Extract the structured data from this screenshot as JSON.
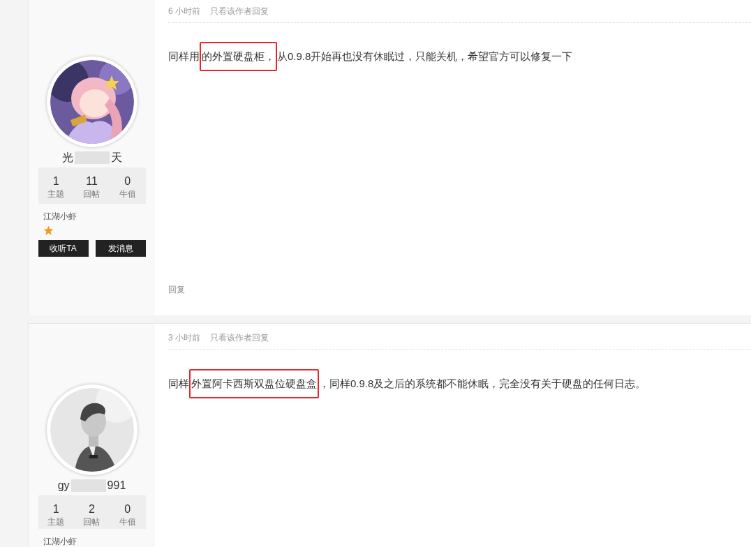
{
  "posts": [
    {
      "user": {
        "name_parts": [
          "光",
          "天"
        ],
        "stats": [
          {
            "value": "1",
            "label": "主题"
          },
          {
            "value": "11",
            "label": "回帖"
          },
          {
            "value": "0",
            "label": "牛值"
          }
        ],
        "level": "江湖小虾",
        "buttons": [
          "收听TA",
          "发消息"
        ]
      },
      "time": "6 小时前",
      "author_only": "只看该作者回复",
      "body": [
        {
          "text": "同样用",
          "highlighted": false
        },
        {
          "text": "的外置硬盘柜，",
          "highlighted": true
        },
        {
          "text": "从0.9.8开始再也没有休眠过，只能关机，希望官方可以修复一下",
          "highlighted": false
        }
      ],
      "reply": "回复"
    },
    {
      "user": {
        "name_parts": [
          "gy",
          "991"
        ],
        "stats": [
          {
            "value": "1",
            "label": "主题"
          },
          {
            "value": "2",
            "label": "回帖"
          },
          {
            "value": "0",
            "label": "牛值"
          }
        ],
        "level": "江湖小虾"
      },
      "time": "3 小时前",
      "author_only": "只看该作者回复",
      "body": [
        {
          "text": "同样",
          "highlighted": false
        },
        {
          "text": "外置阿卡西斯双盘位硬盘盒",
          "highlighted": true
        },
        {
          "text": "，同样0.9.8及之后的系统都不能休眠，完全没有关于硬盘的任何日志。",
          "highlighted": false
        }
      ]
    }
  ]
}
